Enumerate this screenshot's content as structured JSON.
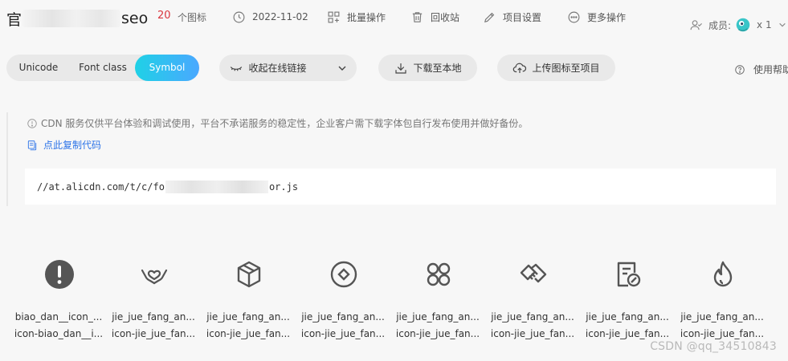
{
  "header": {
    "title_prefix": "官",
    "title_suffix": "seo",
    "icon_count": "20",
    "icon_count_label": "个图标",
    "date": "2022-11-02",
    "batch_label": "批量操作",
    "recycle_label": "回收站",
    "settings_label": "项目设置",
    "more_label": "更多操作",
    "members_label": "成员:",
    "members_count": "x 1"
  },
  "toolbar": {
    "tabs": [
      {
        "label": "Unicode"
      },
      {
        "label": "Font class"
      },
      {
        "label": "Symbol"
      }
    ],
    "collapse_label": "收起在线链接",
    "download_label": "下载至本地",
    "upload_label": "上传图标至项目",
    "help_label": "使用帮助"
  },
  "notice": {
    "text": "CDN 服务仅供平台体验和调试使用，平台不承诺服务的稳定性，企业客户需下载字体包自行发布使用并做好备份。",
    "copy_label": "点此复制代码",
    "code_prefix": "//at.alicdn.com/t/c/fo",
    "code_suffix": "or.js"
  },
  "icons": [
    {
      "name": "biao_dan__icon_...",
      "cls": "icon-biao_dan__i...",
      "icon": "alert-circle-icon"
    },
    {
      "name": "jie_jue_fang_an...",
      "cls": "icon-jie_jue_fan...",
      "icon": "heart-hands-icon"
    },
    {
      "name": "jie_jue_fang_an...",
      "cls": "icon-jie_jue_fan...",
      "icon": "cube-icon"
    },
    {
      "name": "jie_jue_fang_an...",
      "cls": "icon-jie_jue_fan...",
      "icon": "target-circle-icon"
    },
    {
      "name": "jie_jue_fang_an...",
      "cls": "icon-jie_jue_fan...",
      "icon": "four-circles-icon"
    },
    {
      "name": "jie_jue_fang_an...",
      "cls": "icon-jie_jue_fan...",
      "icon": "handshake-icon"
    },
    {
      "name": "jie_jue_fang_an...",
      "cls": "icon-jie_jue_fan...",
      "icon": "document-edit-icon"
    },
    {
      "name": "jie_jue_fang_an...",
      "cls": "icon-jie_jue_fan...",
      "icon": "flame-icon"
    }
  ],
  "watermark": "CSDN @qq_34510843"
}
